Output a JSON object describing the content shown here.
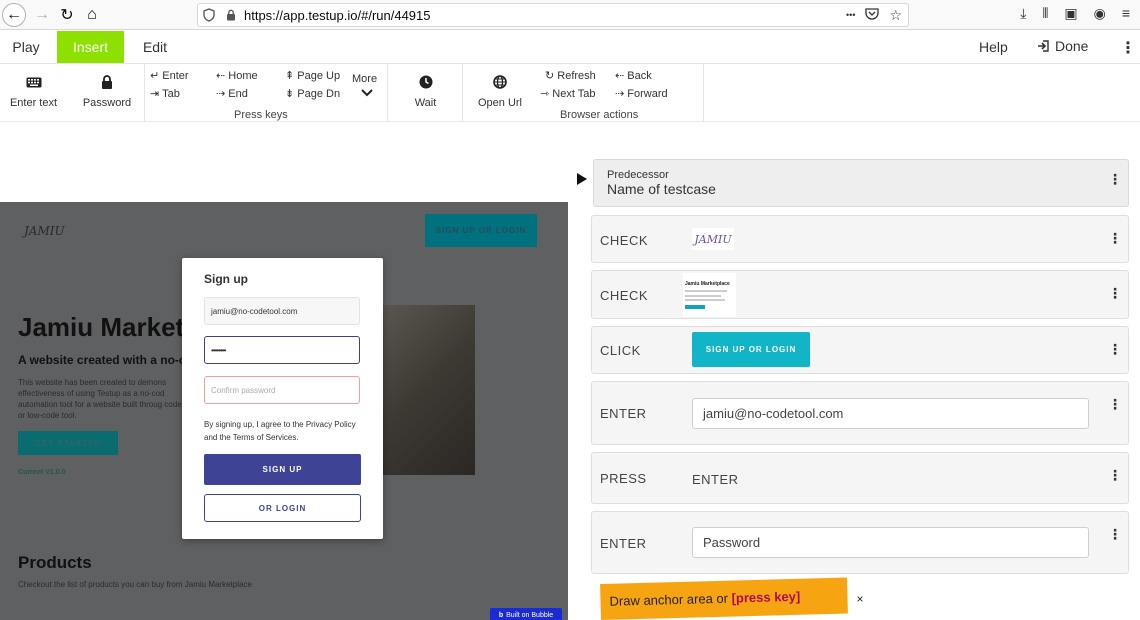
{
  "browser": {
    "url_prefix": "https://app.",
    "url_domain": "testup.io",
    "url_suffix": "/#/run/44915",
    "more_glyph": "•••"
  },
  "menu": {
    "play": "Play",
    "insert": "Insert",
    "edit": "Edit",
    "help": "Help",
    "done": "Done",
    "insert_color": "#8ee000"
  },
  "toolbar": {
    "enter_text": "Enter text",
    "password": "Password",
    "keys": {
      "enter": "↵ Enter",
      "tab": "⇥ Tab",
      "home": "⇠ Home",
      "end": "⇢ End",
      "page_up": "⇞ Page Up",
      "page_dn": "⇟ Page Dn",
      "more": "More"
    },
    "press_keys_label": "Press keys",
    "wait": "Wait",
    "open_url": "Open Url",
    "refresh": "↻ Refresh",
    "next_tab": "⇾ Next Tab",
    "back": "⇠ Back",
    "forward": "⇢ Forward",
    "browser_actions_label": "Browser actions"
  },
  "preview": {
    "logo": "JAMIU",
    "top_button": "SIGN UP OR LOGIN",
    "title": "Jamiu Market",
    "subtitle": "A website created with a no-co",
    "paragraph": "This website has been created to demons effectiveness of using Testup as a no-cod automation tool for a website built throug code or low-code tool.",
    "cta": "GET STARTED",
    "version": "Current V1.0.0",
    "products_title": "Products",
    "products_sub": "Checkout the list of products you can buy from Jamiu Marketplace",
    "bubble": "Built on Bubble",
    "modal": {
      "title": "Sign up",
      "email_value": "jamiu@no-codetool.com",
      "password_value": "••••••••",
      "confirm_placeholder": "Confirm password",
      "terms": "By signing up, I agree to the Privacy Policy and the Terms of Services.",
      "signup_button": "SIGN UP",
      "login_button": "OR LOGIN"
    }
  },
  "steps": {
    "predecessor_label": "Predecessor",
    "predecessor_name": "Name of testcase",
    "items": [
      {
        "action": "CHECK",
        "logo_text": "JAMIU"
      },
      {
        "action": "CHECK",
        "thumb_title": "Jamiu Marketplace"
      },
      {
        "action": "CLICK",
        "button_text": "SIGN UP OR LOGIN"
      },
      {
        "action": "ENTER",
        "value": "jamiu@no-codetool.com"
      },
      {
        "action": "PRESS",
        "value": "ENTER"
      },
      {
        "action": "ENTER",
        "value": "Password"
      }
    ]
  },
  "toast": {
    "text": "Draw anchor area or ",
    "key": "[press key]",
    "close": "×"
  }
}
